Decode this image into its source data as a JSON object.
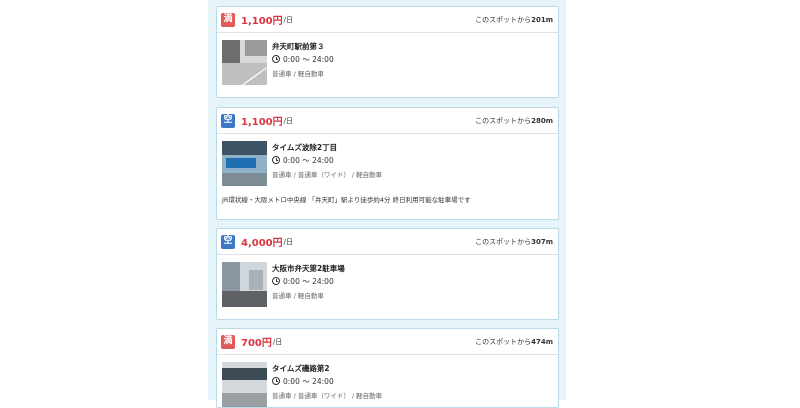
{
  "listings": [
    {
      "status_label": "満",
      "price": "1,100円",
      "unit": "/日",
      "distance_prefix": "このスポットから",
      "distance": "201m",
      "name": "弁天町駅前第３",
      "hours": "0:00 〜 24:00",
      "vehicles": "普通車 / 軽自動車",
      "description": ""
    },
    {
      "status_label": "空",
      "price": "1,100円",
      "unit": "/日",
      "distance_prefix": "このスポットから",
      "distance": "280m",
      "name": "タイムズ波除2丁目",
      "hours": "0:00 〜 24:00",
      "vehicles": "普通車 / 普通車（ワイド） / 軽自動車",
      "description": "JR環状線・大阪メトロ中央線 「弁天町」駅より徒歩約4分 終日利用可能な駐車場です"
    },
    {
      "status_label": "空",
      "price": "4,000円",
      "unit": "/日",
      "distance_prefix": "このスポットから",
      "distance": "307m",
      "name": "大阪市弁天第2駐車場",
      "hours": "0:00 〜 24:00",
      "vehicles": "普通車 / 軽自動車",
      "description": ""
    },
    {
      "status_label": "満",
      "price": "700円",
      "unit": "/日",
      "distance_prefix": "このスポットから",
      "distance": "474m",
      "name": "タイムズ磯路第2",
      "hours": "0:00 〜 24:00",
      "vehicles": "普通車 / 普通車（ワイド） / 軽自動車",
      "description": ""
    }
  ]
}
